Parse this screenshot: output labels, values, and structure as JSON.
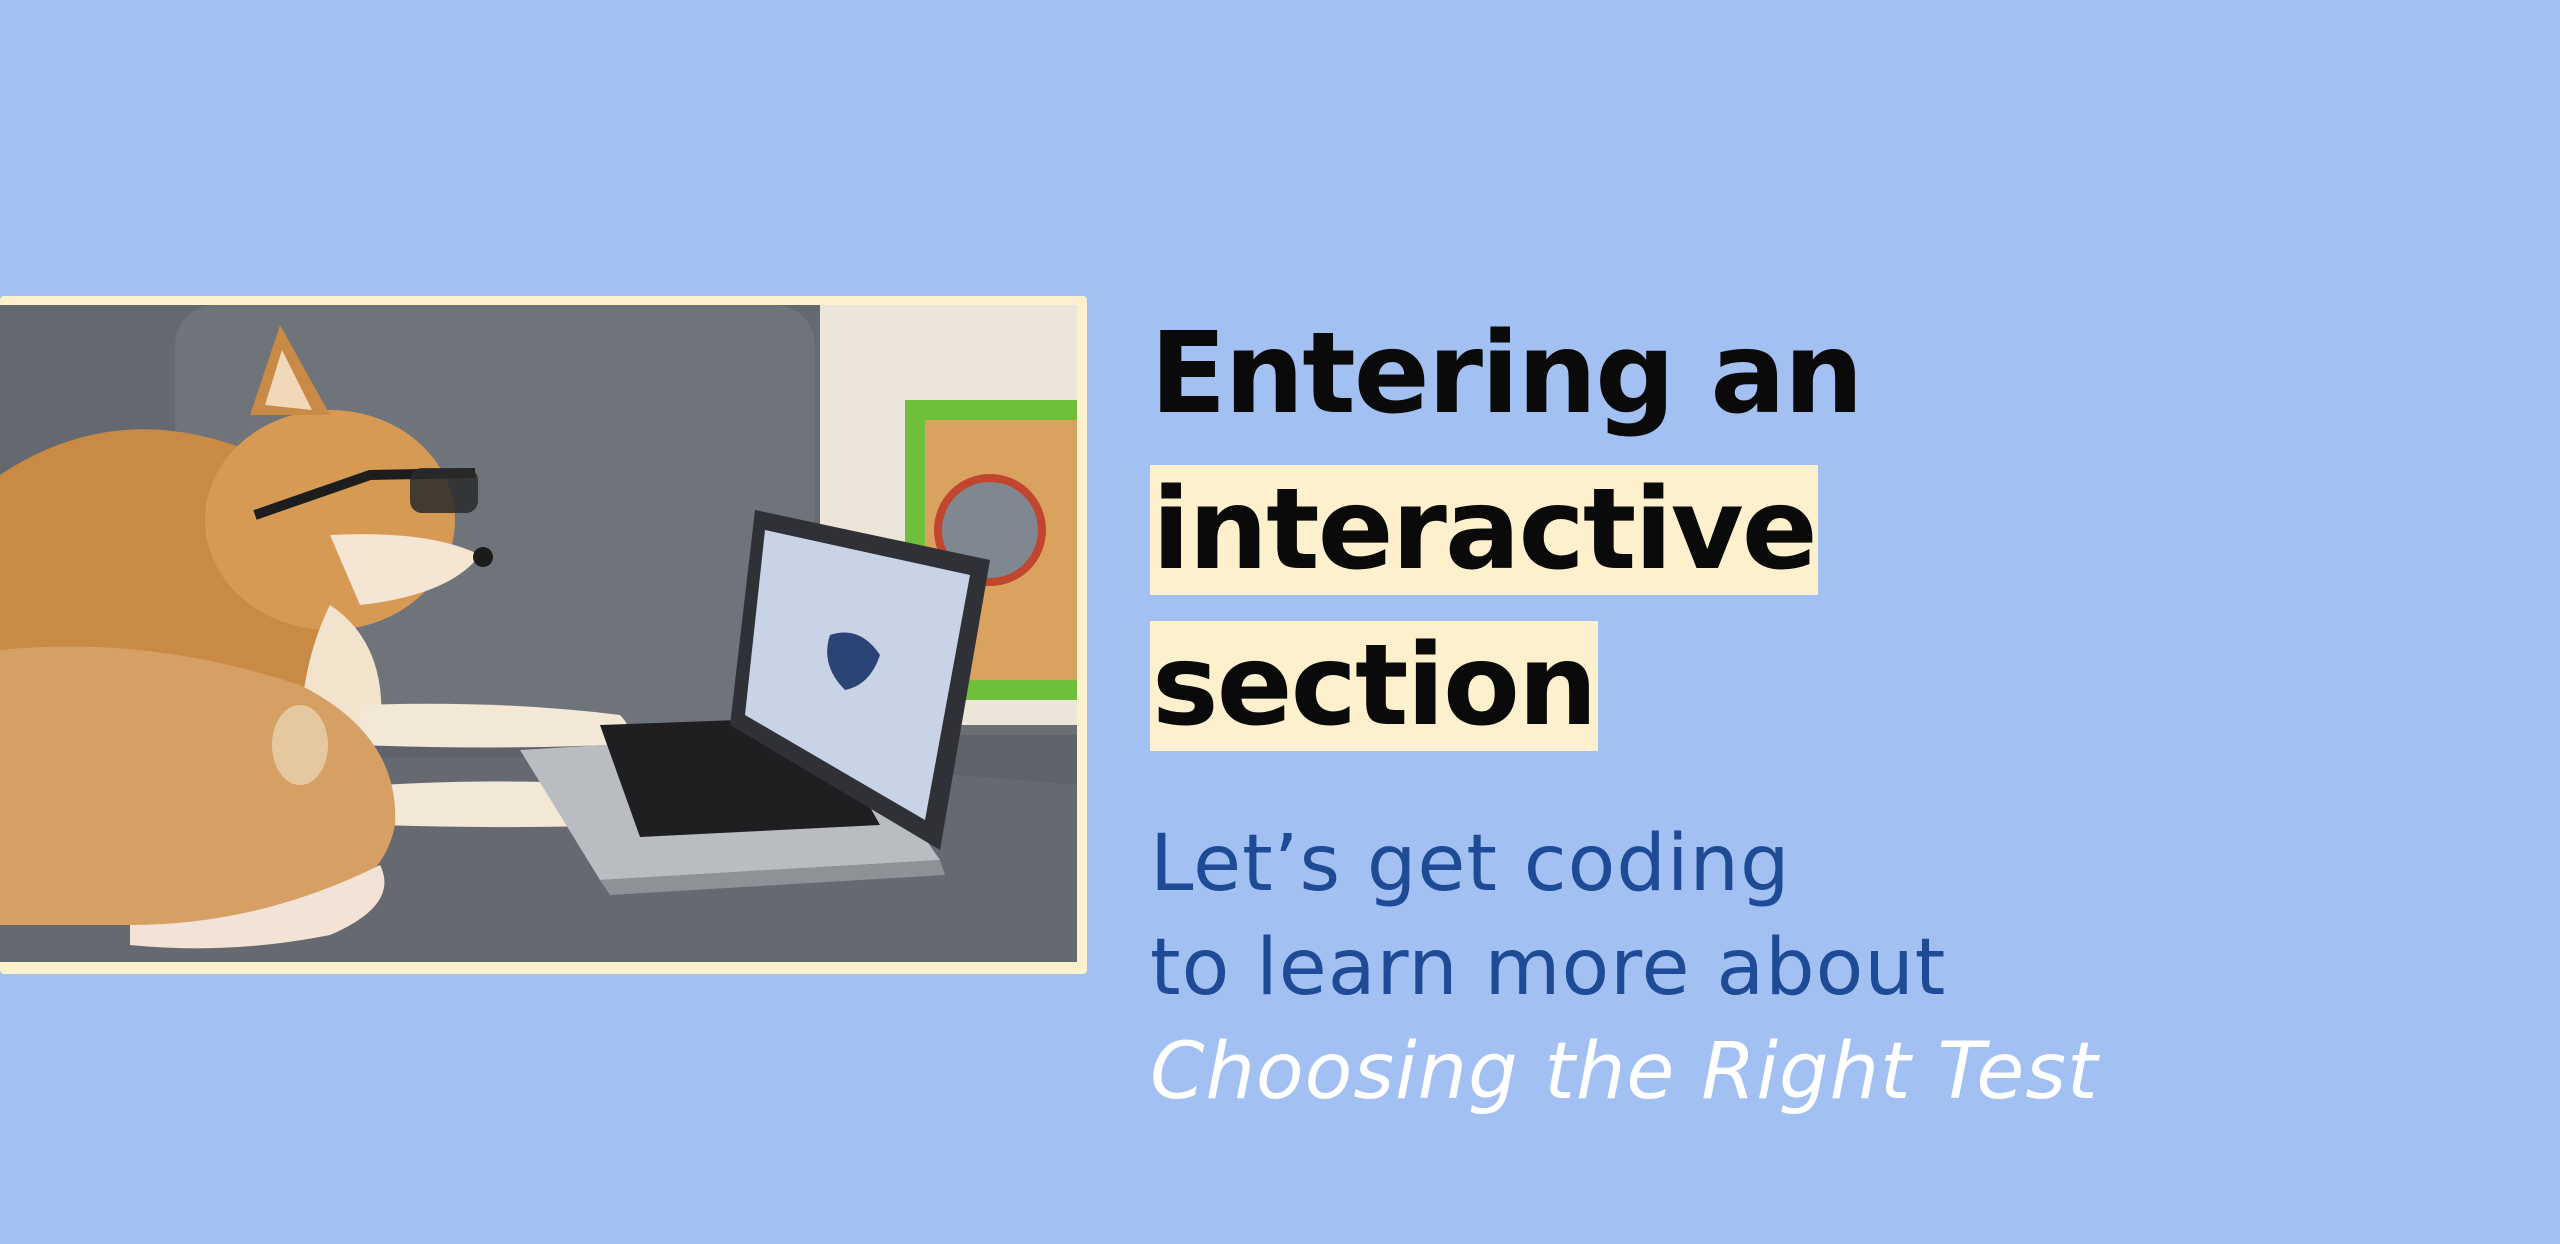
{
  "slide": {
    "background_color": "#a3c0f2",
    "highlight_color": "#fdf0cd",
    "heading_part1": "Entering an",
    "heading_part2": "interactive",
    "heading_part3": "section",
    "subtitle_line1": "Let’s get coding",
    "subtitle_line2": "to learn more about",
    "subtitle_topic": "Choosing the Right Test",
    "subtitle_color": "#1f4a96",
    "topic_color": "#ffffff"
  },
  "illustration": {
    "icon": "shiba-dog-coding-photo"
  }
}
